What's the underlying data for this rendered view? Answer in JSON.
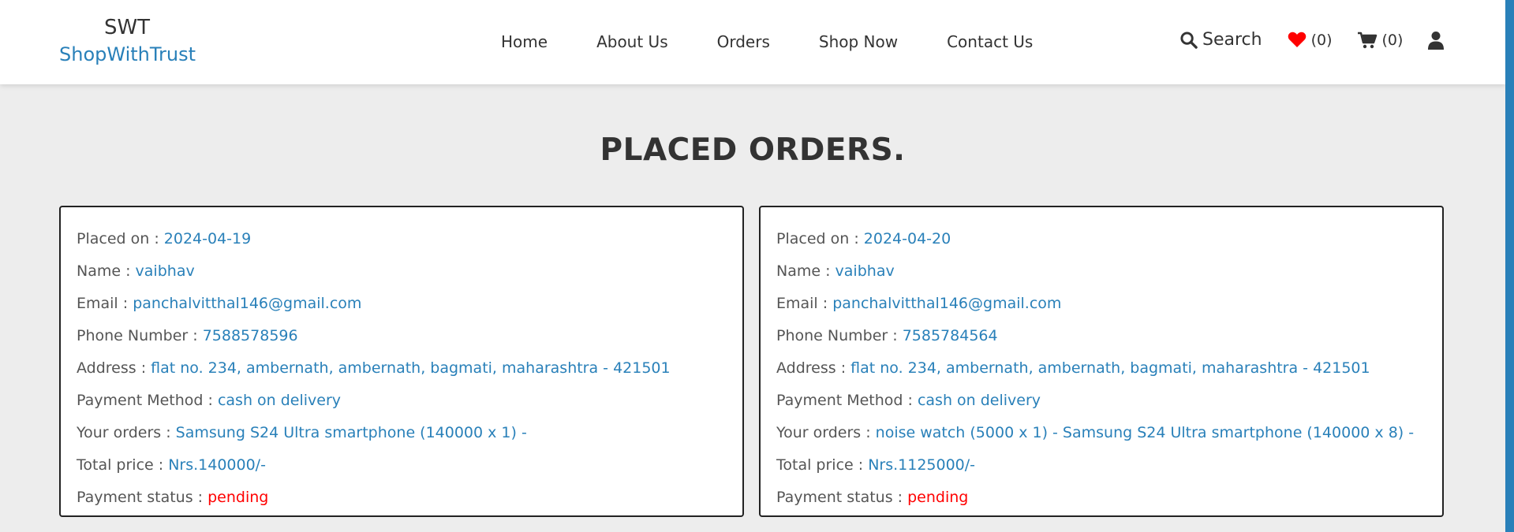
{
  "brand": {
    "line1": "SWT",
    "line2": "ShopWithTrust"
  },
  "nav": [
    {
      "label": "Home"
    },
    {
      "label": "About Us"
    },
    {
      "label": "Orders"
    },
    {
      "label": "Shop Now"
    },
    {
      "label": "Contact Us"
    }
  ],
  "header_icons": {
    "search_label": "Search",
    "wishlist_count": "(0)",
    "cart_count": "(0)"
  },
  "page_title": "PLACED ORDERS.",
  "labels": {
    "placed_on": "Placed on : ",
    "name": "Name : ",
    "email": "Email : ",
    "phone": "Phone Number : ",
    "address": "Address : ",
    "payment_method": "Payment Method : ",
    "your_orders": "Your orders : ",
    "total_price": "Total price : ",
    "payment_status": "Payment status : "
  },
  "orders": [
    {
      "placed_on": "2024-04-19",
      "name": "vaibhav",
      "email": "panchalvitthal146@gmail.com",
      "phone": "7588578596",
      "address": "flat no. 234, ambernath, ambernath, bagmati, maharashtra - 421501",
      "payment_method": "cash on delivery",
      "your_orders": "Samsung S24 Ultra smartphone (140000 x 1) -",
      "total_price": "Nrs.140000/-",
      "payment_status": "pending"
    },
    {
      "placed_on": "2024-04-20",
      "name": "vaibhav",
      "email": "panchalvitthal146@gmail.com",
      "phone": "7585784564",
      "address": "flat no. 234, ambernath, ambernath, bagmati, maharashtra - 421501",
      "payment_method": "cash on delivery",
      "your_orders": "noise watch (5000 x 1) - Samsung S24 Ultra smartphone (140000 x 8) -",
      "total_price": "Nrs.1125000/-",
      "payment_status": "pending"
    }
  ],
  "colors": {
    "accent": "#2980b9",
    "status_pending": "#ff0000",
    "heart": "#ff0000"
  }
}
